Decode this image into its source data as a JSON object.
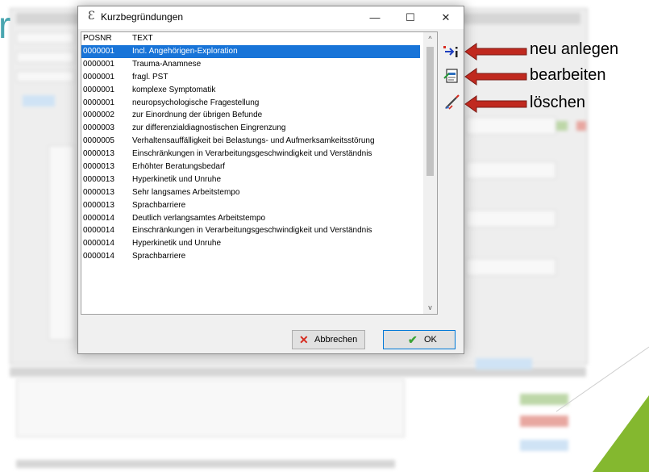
{
  "dialog": {
    "title": "Kurzbegründungen",
    "controls": {
      "minimize": "—",
      "maximize": "☐",
      "close": "✕"
    },
    "columns": [
      "POSNR",
      "TEXT"
    ],
    "rows": [
      {
        "posnr": "0000001",
        "text": "Incl. Angehörigen-Exploration",
        "selected": true
      },
      {
        "posnr": "0000001",
        "text": "Trauma-Anamnese"
      },
      {
        "posnr": "0000001",
        "text": "fragl. PST"
      },
      {
        "posnr": "0000001",
        "text": "komplexe Symptomatik"
      },
      {
        "posnr": "0000001",
        "text": "neuropsychologische Fragestellung"
      },
      {
        "posnr": "0000002",
        "text": "zur Einordnung der übrigen Befunde"
      },
      {
        "posnr": "0000003",
        "text": "zur differenzialdiagnostischen Eingrenzung"
      },
      {
        "posnr": "0000005",
        "text": "Verhaltensauffälligkeit bei Belastungs- und Aufmerksamkeitsstörung"
      },
      {
        "posnr": "0000013",
        "text": "Einschränkungen in Verarbeitungsgeschwindigkeit und Verständnis"
      },
      {
        "posnr": "0000013",
        "text": "Erhöhter Beratungsbedarf"
      },
      {
        "posnr": "0000013",
        "text": "Hyperkinetik und Unruhe"
      },
      {
        "posnr": "0000013",
        "text": "Sehr langsames Arbeitstempo"
      },
      {
        "posnr": "0000013",
        "text": "Sprachbarriere"
      },
      {
        "posnr": "0000014",
        "text": "Deutlich verlangsamtes Arbeitstempo"
      },
      {
        "posnr": "0000014",
        "text": "Einschränkungen in Verarbeitungsgeschwindigkeit und Verständnis"
      },
      {
        "posnr": "0000014",
        "text": "Hyperkinetik und Unruhe"
      },
      {
        "posnr": "0000014",
        "text": "Sprachbarriere"
      }
    ],
    "scroll": {
      "up": "^",
      "down": "v"
    },
    "tools": [
      "new-icon",
      "edit-icon",
      "delete-icon"
    ],
    "buttons": {
      "cancel": "Abbrechen",
      "ok": "OK"
    }
  },
  "annotations": {
    "new": "neu anlegen",
    "edit": "bearbeiten",
    "delete": "löschen"
  },
  "slide_letter": "r",
  "colors": {
    "selection": "#1874d8",
    "arrow_fill": "#c0291f",
    "slide_accent": "#4aa6b0",
    "deco_green": "#84b82f"
  }
}
